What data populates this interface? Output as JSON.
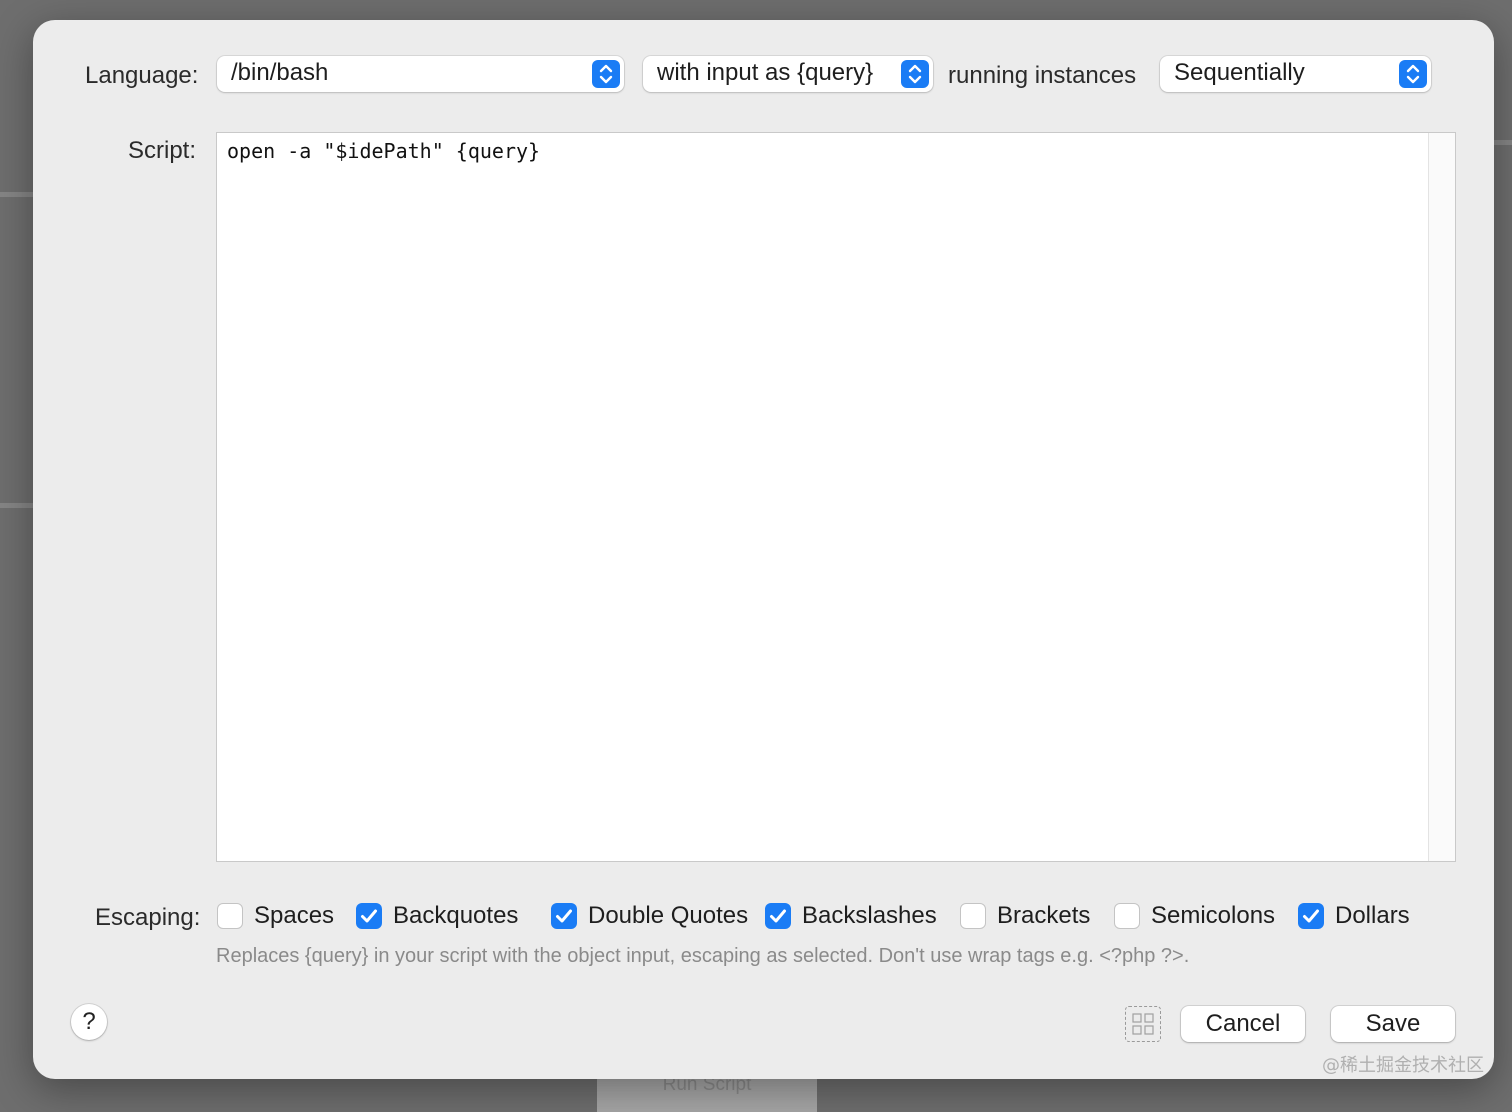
{
  "background": {
    "node_label": "Run Script"
  },
  "dialog": {
    "language_label": "Language:",
    "language_value": "/bin/bash",
    "input_mode_value": "with input as {query}",
    "running_instances_label": "running instances",
    "running_instances_value": "Sequentially",
    "script_label": "Script:",
    "script_text": "open -a \"$idePath\" {query}",
    "escaping_label": "Escaping:",
    "escaping_options": [
      {
        "label": "Spaces",
        "checked": false
      },
      {
        "label": "Backquotes",
        "checked": true
      },
      {
        "label": "Double Quotes",
        "checked": true
      },
      {
        "label": "Backslashes",
        "checked": true
      },
      {
        "label": "Brackets",
        "checked": false
      },
      {
        "label": "Semicolons",
        "checked": false
      },
      {
        "label": "Dollars",
        "checked": true
      }
    ],
    "hint": "Replaces {query} in your script with the object input, escaping as selected. Don't use wrap tags e.g. <?php ?>.",
    "help_label": "?",
    "cancel_label": "Cancel",
    "save_label": "Save"
  },
  "watermark": "@稀土掘金技术社区",
  "colors": {
    "accent": "#1a7cf5",
    "dialog_bg": "#ececec",
    "backdrop": "#6e6e6e"
  },
  "icons": [
    "stepper-icon",
    "checkmark-icon",
    "help-icon",
    "grid-icon"
  ]
}
